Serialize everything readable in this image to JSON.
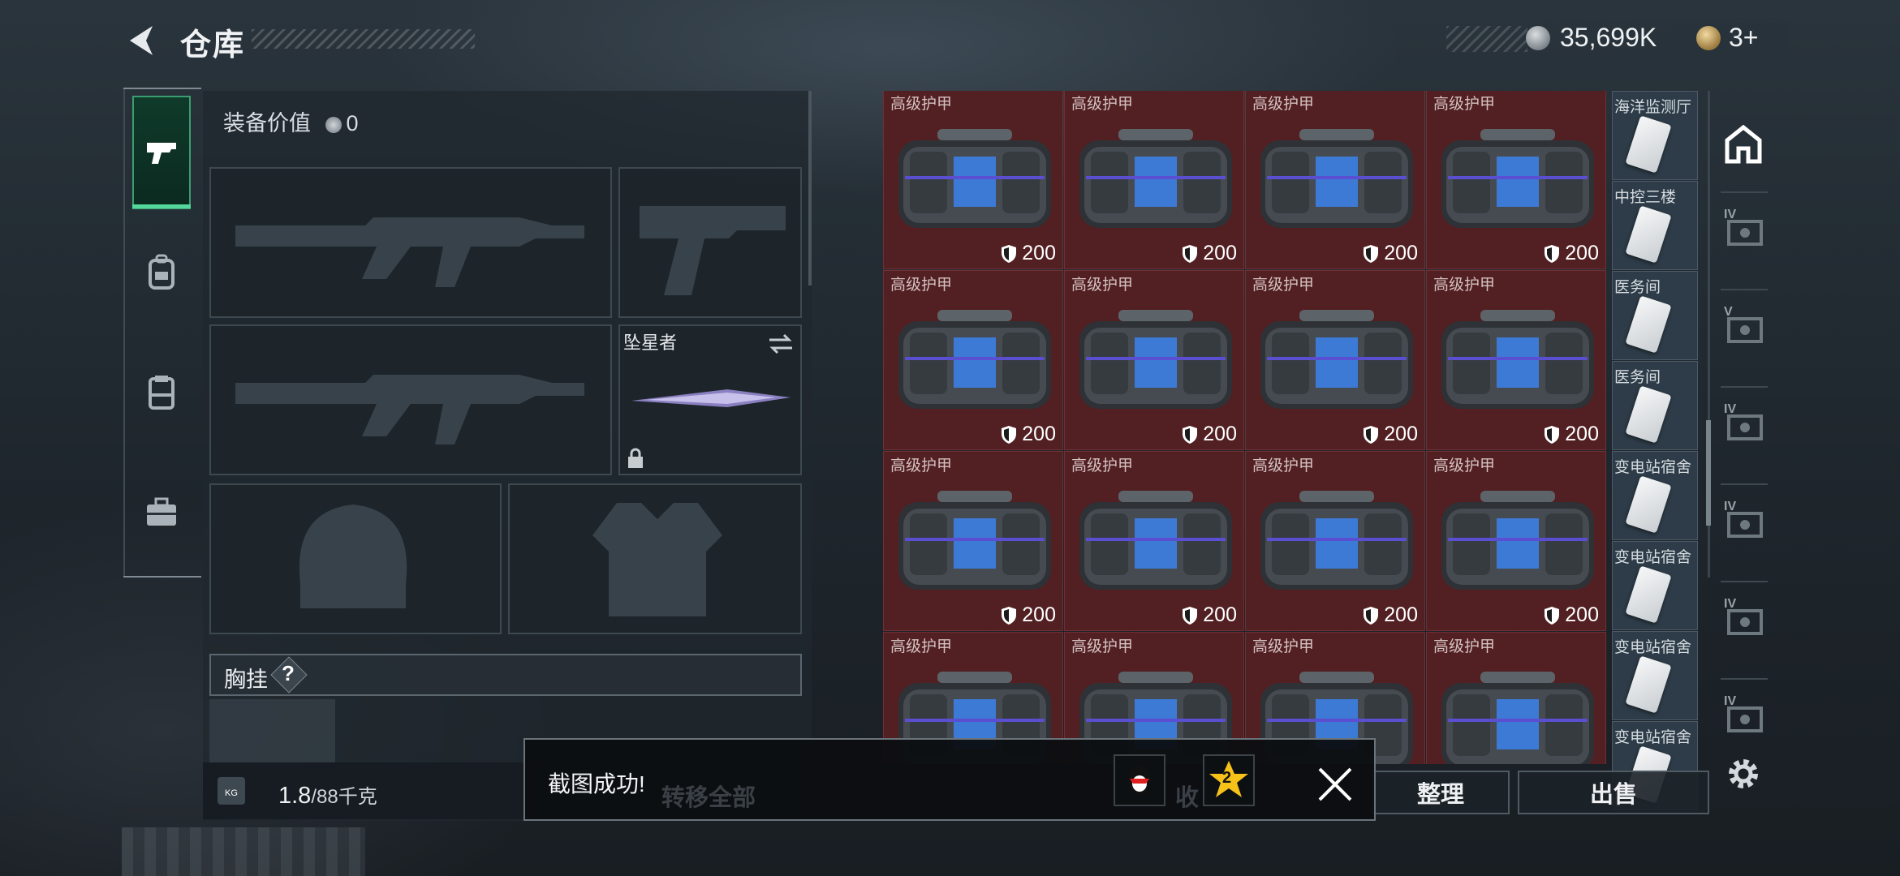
{
  "header": {
    "title": "仓库",
    "currency1": "35,699K",
    "currency2": "3+"
  },
  "equipment": {
    "value_label": "装备价值",
    "value": "0",
    "melee_name": "坠星者",
    "chest_rig_label": "胸挂",
    "chest_rig_help": "?",
    "weight_current": "1.8",
    "weight_max": "/88千克",
    "weight_icon": "KG"
  },
  "nav": [
    {
      "icon": "pistol-icon"
    },
    {
      "icon": "backpack-icon"
    },
    {
      "icon": "clipboard-icon"
    },
    {
      "icon": "briefcase-icon"
    }
  ],
  "grid": {
    "rows": [
      [
        {
          "label": "高级护甲",
          "armor": "200"
        },
        {
          "label": "高级护甲",
          "armor": "200"
        },
        {
          "label": "高级护甲",
          "armor": "200"
        },
        {
          "label": "高级护甲",
          "armor": "200"
        }
      ],
      [
        {
          "label": "高级护甲",
          "armor": "200"
        },
        {
          "label": "高级护甲",
          "armor": "200"
        },
        {
          "label": "高级护甲",
          "armor": "200"
        },
        {
          "label": "高级护甲",
          "armor": "200"
        }
      ],
      [
        {
          "label": "高级护甲",
          "armor": "200"
        },
        {
          "label": "高级护甲",
          "armor": "200"
        },
        {
          "label": "高级护甲",
          "armor": "200"
        },
        {
          "label": "高级护甲",
          "armor": "200"
        }
      ],
      [
        {
          "label": "高级护甲",
          "armor": ""
        },
        {
          "label": "高级护甲",
          "armor": ""
        },
        {
          "label": "高级护甲",
          "armor": ""
        },
        {
          "label": "高级护甲",
          "armor": ""
        }
      ]
    ],
    "keycards": [
      "海洋监测厅",
      "中控三楼",
      "医务间",
      "医务间",
      "变电站宿舍",
      "变电站宿舍",
      "变电站宿舍",
      "变电站宿舍"
    ]
  },
  "side_tabs": [
    "IV",
    "V",
    "IV",
    "IV",
    "IV",
    "IV"
  ],
  "actions": {
    "transfer_all": "转移全部",
    "collect": "收",
    "organize": "整理",
    "sell": "出售"
  },
  "toast": {
    "message": "截图成功!",
    "qq_badge": "2"
  }
}
